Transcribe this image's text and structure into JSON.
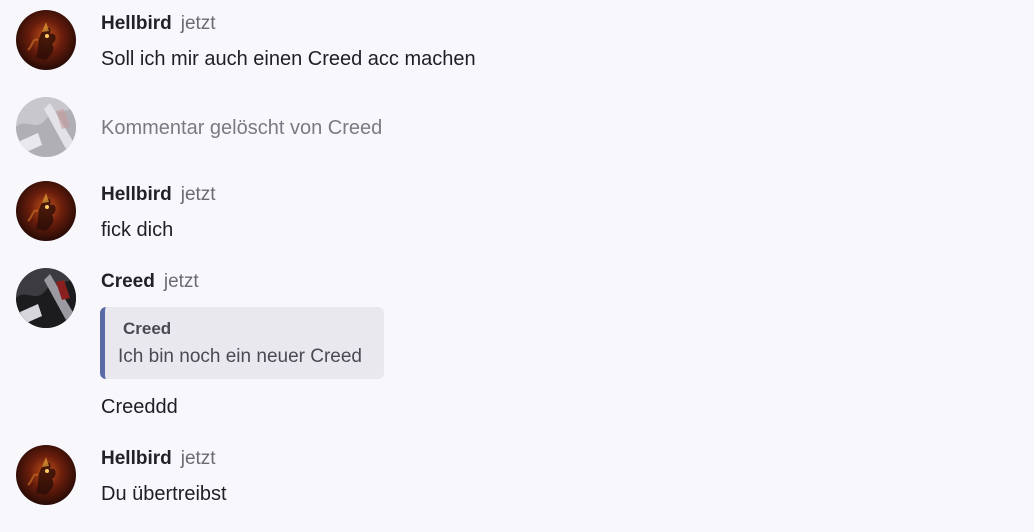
{
  "messages": [
    {
      "author": "Hellbird",
      "time": "jetzt",
      "text": "Soll ich mir auch einen Creed acc machen",
      "avatar": "hellbird-avatar"
    },
    {
      "deleted_text": "Kommentar gelöscht von Creed",
      "avatar": "creed-avatar"
    },
    {
      "author": "Hellbird",
      "time": "jetzt",
      "text": "fick dich",
      "avatar": "hellbird-avatar"
    },
    {
      "author": "Creed",
      "time": "jetzt",
      "quote": {
        "author": "Creed",
        "text": "Ich bin noch ein neuer Creed"
      },
      "text": "Creeddd",
      "avatar": "creed-avatar"
    },
    {
      "author": "Hellbird",
      "time": "jetzt",
      "text": "Du übertreibst",
      "avatar": "hellbird-avatar"
    }
  ],
  "colors": {
    "background": "#f8f7fc",
    "quote_bar": "#5a6aa6",
    "quote_bg": "#e9e8ef",
    "muted": "#7a7a82"
  }
}
